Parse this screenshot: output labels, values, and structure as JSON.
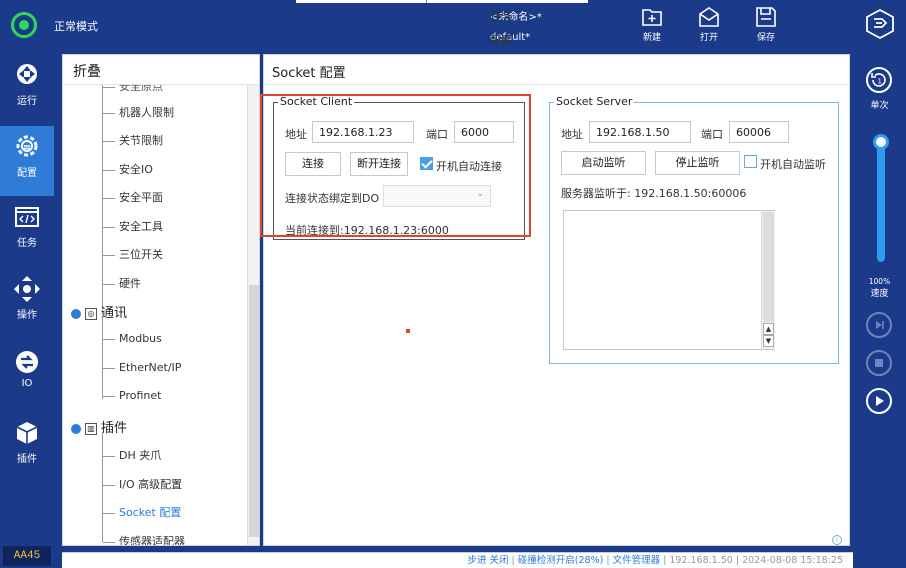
{
  "top": {
    "mode": "正常模式",
    "task_label": "任务",
    "task_value": "<未命名>*",
    "config_label": "配置",
    "config_value": "default*",
    "btn_new": "新建",
    "btn_open": "打开",
    "btn_save": "保存"
  },
  "nav": {
    "run": "运行",
    "config": "配置",
    "task": "任务",
    "operate": "操作",
    "io": "IO",
    "plugin": "插件"
  },
  "badge": "AA45",
  "right": {
    "single": "单次",
    "speed_value": "100%",
    "speed_label": "速度",
    "speed_level": 1.0
  },
  "tree": {
    "title": "折叠",
    "partial": "安全原点",
    "items_safety": [
      "机器人限制",
      "关节限制",
      "安全IO",
      "安全平面",
      "安全工具",
      "三位开关",
      "硬件"
    ],
    "group_comm": "通讯",
    "items_comm": [
      "Modbus",
      "EtherNet/IP",
      "Profinet"
    ],
    "group_plugin": "插件",
    "items_plugin": [
      "DH 夹爪",
      "I/O 高级配置",
      "Socket 配置",
      "传感器适配器"
    ]
  },
  "main": {
    "title": "Socket 配置",
    "client": {
      "legend": "Socket Client",
      "addr_label": "地址",
      "addr": "192.168.1.23",
      "port_label": "端口",
      "port": "6000",
      "connect": "连接",
      "disconnect": "断开连接",
      "autoconnect": "开机自动连接",
      "autoconnect_checked": true,
      "bind_do_label": "连接状态绑定到DO",
      "current": "当前连接到:192.168.1.23:6000"
    },
    "server": {
      "legend": "Socket Server",
      "addr_label": "地址",
      "addr": "192.168.1.50",
      "port_label": "端口",
      "port": "60006",
      "start": "启动监听",
      "stop": "停止监听",
      "autolisten": "开机自动监听",
      "autolisten_checked": false,
      "listening": "服务器监听于: 192.168.1.50:60006"
    }
  },
  "status": {
    "step": "步进 关闭",
    "collision": "碰撞检测开启(28%)",
    "filemgr": "文件管理器",
    "ip": "192.168.1.50",
    "datetime": "2024-08-08 15:18:25"
  },
  "colors": {
    "nav_bg": "#1b3a8a",
    "accent": "#2e7cd6",
    "mode_green": "#2fd65a",
    "highlight_red": "#e0432f"
  }
}
